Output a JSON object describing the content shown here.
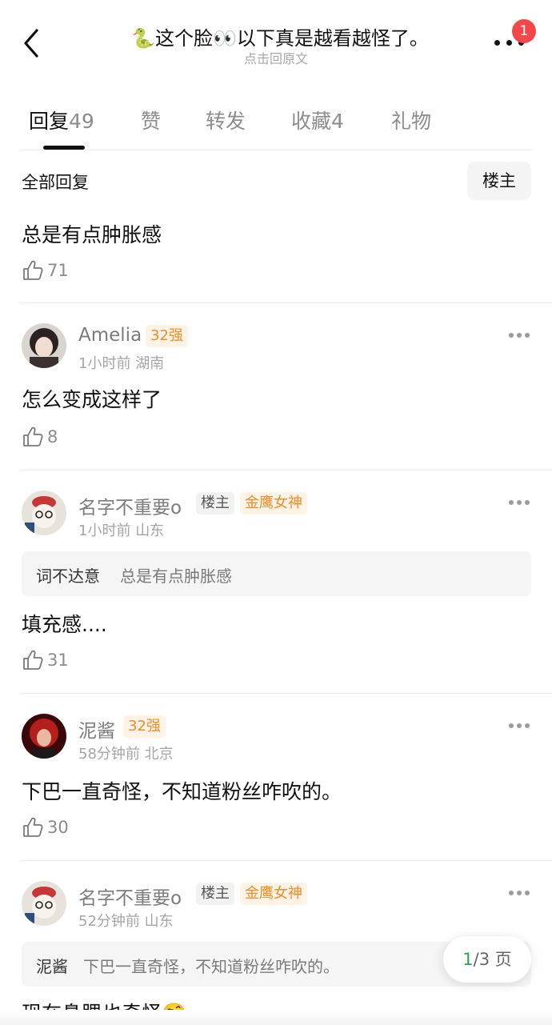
{
  "header": {
    "title": "🐍这个脸👀以下真是越看越怪了。",
    "subtitle": "点击回原文",
    "badge_count": "1",
    "back_icon": "chevron-left-icon",
    "more_icon": "more-dots-icon"
  },
  "tabs": [
    {
      "label": "回复",
      "count": "49",
      "active": true
    },
    {
      "label": "赞",
      "count": "",
      "active": false
    },
    {
      "label": "转发",
      "count": "",
      "active": false
    },
    {
      "label": "收藏",
      "count": "4",
      "active": false
    },
    {
      "label": "礼物",
      "count": "",
      "active": false
    }
  ],
  "filter": {
    "all_label": "全部回复",
    "owner_label": "楼主"
  },
  "comments": [
    {
      "text": "总是有点肿胀感",
      "likes": "71"
    },
    {
      "user": "Amelia",
      "level": "32强",
      "time": "1小时前",
      "location": "湖南",
      "text": "怎么变成这样了",
      "likes": "8"
    },
    {
      "user": "名字不重要o",
      "owner_tag": "楼主",
      "level": "金鹰女神",
      "time": "1小时前",
      "location": "山东",
      "quote_author": "词不达意",
      "quote_text": "总是有点肿胀感",
      "text": "填充感....",
      "likes": "31"
    },
    {
      "user": "泥酱",
      "level": "32强",
      "time": "58分钟前",
      "location": "北京",
      "text": "下巴一直奇怪，不知道粉丝咋吹的。",
      "likes": "30"
    },
    {
      "user": "名字不重要o",
      "owner_tag": "楼主",
      "level": "金鹰女神",
      "time": "52分钟前",
      "location": "山东",
      "quote_author": "泥酱",
      "quote_text": "下巴一直奇怪，不知道粉丝咋吹的。",
      "text": "现在鼻腮也奇怪🤨"
    }
  ],
  "pager": {
    "current": "1",
    "total_text": "/3 页"
  },
  "colors": {
    "accent_badge": "#f2484b",
    "level_text": "#ef8c2a",
    "pager_current": "#2aa350"
  }
}
